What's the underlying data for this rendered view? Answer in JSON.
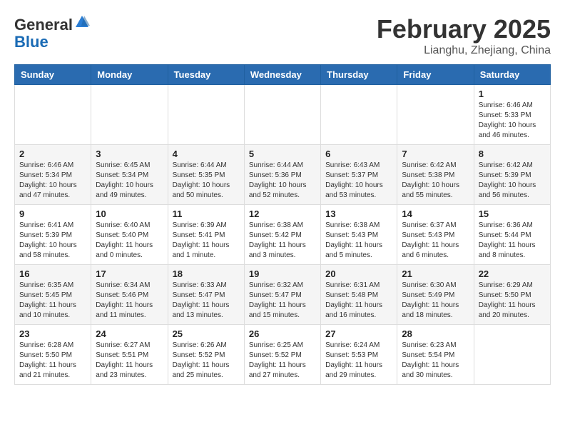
{
  "header": {
    "logo_general": "General",
    "logo_blue": "Blue",
    "month_title": "February 2025",
    "location": "Lianghu, Zhejiang, China"
  },
  "weekdays": [
    "Sunday",
    "Monday",
    "Tuesday",
    "Wednesday",
    "Thursday",
    "Friday",
    "Saturday"
  ],
  "weeks": [
    [
      {
        "day": "",
        "info": ""
      },
      {
        "day": "",
        "info": ""
      },
      {
        "day": "",
        "info": ""
      },
      {
        "day": "",
        "info": ""
      },
      {
        "day": "",
        "info": ""
      },
      {
        "day": "",
        "info": ""
      },
      {
        "day": "1",
        "info": "Sunrise: 6:46 AM\nSunset: 5:33 PM\nDaylight: 10 hours\nand 46 minutes."
      }
    ],
    [
      {
        "day": "2",
        "info": "Sunrise: 6:46 AM\nSunset: 5:34 PM\nDaylight: 10 hours\nand 47 minutes."
      },
      {
        "day": "3",
        "info": "Sunrise: 6:45 AM\nSunset: 5:34 PM\nDaylight: 10 hours\nand 49 minutes."
      },
      {
        "day": "4",
        "info": "Sunrise: 6:44 AM\nSunset: 5:35 PM\nDaylight: 10 hours\nand 50 minutes."
      },
      {
        "day": "5",
        "info": "Sunrise: 6:44 AM\nSunset: 5:36 PM\nDaylight: 10 hours\nand 52 minutes."
      },
      {
        "day": "6",
        "info": "Sunrise: 6:43 AM\nSunset: 5:37 PM\nDaylight: 10 hours\nand 53 minutes."
      },
      {
        "day": "7",
        "info": "Sunrise: 6:42 AM\nSunset: 5:38 PM\nDaylight: 10 hours\nand 55 minutes."
      },
      {
        "day": "8",
        "info": "Sunrise: 6:42 AM\nSunset: 5:39 PM\nDaylight: 10 hours\nand 56 minutes."
      }
    ],
    [
      {
        "day": "9",
        "info": "Sunrise: 6:41 AM\nSunset: 5:39 PM\nDaylight: 10 hours\nand 58 minutes."
      },
      {
        "day": "10",
        "info": "Sunrise: 6:40 AM\nSunset: 5:40 PM\nDaylight: 11 hours\nand 0 minutes."
      },
      {
        "day": "11",
        "info": "Sunrise: 6:39 AM\nSunset: 5:41 PM\nDaylight: 11 hours\nand 1 minute."
      },
      {
        "day": "12",
        "info": "Sunrise: 6:38 AM\nSunset: 5:42 PM\nDaylight: 11 hours\nand 3 minutes."
      },
      {
        "day": "13",
        "info": "Sunrise: 6:38 AM\nSunset: 5:43 PM\nDaylight: 11 hours\nand 5 minutes."
      },
      {
        "day": "14",
        "info": "Sunrise: 6:37 AM\nSunset: 5:43 PM\nDaylight: 11 hours\nand 6 minutes."
      },
      {
        "day": "15",
        "info": "Sunrise: 6:36 AM\nSunset: 5:44 PM\nDaylight: 11 hours\nand 8 minutes."
      }
    ],
    [
      {
        "day": "16",
        "info": "Sunrise: 6:35 AM\nSunset: 5:45 PM\nDaylight: 11 hours\nand 10 minutes."
      },
      {
        "day": "17",
        "info": "Sunrise: 6:34 AM\nSunset: 5:46 PM\nDaylight: 11 hours\nand 11 minutes."
      },
      {
        "day": "18",
        "info": "Sunrise: 6:33 AM\nSunset: 5:47 PM\nDaylight: 11 hours\nand 13 minutes."
      },
      {
        "day": "19",
        "info": "Sunrise: 6:32 AM\nSunset: 5:47 PM\nDaylight: 11 hours\nand 15 minutes."
      },
      {
        "day": "20",
        "info": "Sunrise: 6:31 AM\nSunset: 5:48 PM\nDaylight: 11 hours\nand 16 minutes."
      },
      {
        "day": "21",
        "info": "Sunrise: 6:30 AM\nSunset: 5:49 PM\nDaylight: 11 hours\nand 18 minutes."
      },
      {
        "day": "22",
        "info": "Sunrise: 6:29 AM\nSunset: 5:50 PM\nDaylight: 11 hours\nand 20 minutes."
      }
    ],
    [
      {
        "day": "23",
        "info": "Sunrise: 6:28 AM\nSunset: 5:50 PM\nDaylight: 11 hours\nand 21 minutes."
      },
      {
        "day": "24",
        "info": "Sunrise: 6:27 AM\nSunset: 5:51 PM\nDaylight: 11 hours\nand 23 minutes."
      },
      {
        "day": "25",
        "info": "Sunrise: 6:26 AM\nSunset: 5:52 PM\nDaylight: 11 hours\nand 25 minutes."
      },
      {
        "day": "26",
        "info": "Sunrise: 6:25 AM\nSunset: 5:52 PM\nDaylight: 11 hours\nand 27 minutes."
      },
      {
        "day": "27",
        "info": "Sunrise: 6:24 AM\nSunset: 5:53 PM\nDaylight: 11 hours\nand 29 minutes."
      },
      {
        "day": "28",
        "info": "Sunrise: 6:23 AM\nSunset: 5:54 PM\nDaylight: 11 hours\nand 30 minutes."
      },
      {
        "day": "",
        "info": ""
      }
    ]
  ]
}
